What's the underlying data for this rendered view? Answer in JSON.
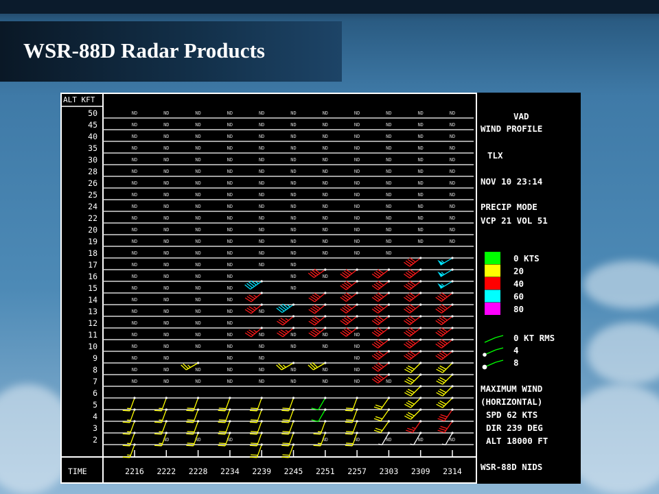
{
  "slide": {
    "title": "WSR-88D Radar Products"
  },
  "chart_data": {
    "type": "vad-wind-profile",
    "ylabel": "ALT KFT",
    "xlabel": "TIME",
    "y_ticks": [
      50,
      45,
      40,
      35,
      30,
      28,
      26,
      25,
      24,
      22,
      20,
      19,
      18,
      17,
      16,
      15,
      14,
      13,
      12,
      11,
      10,
      9,
      8,
      7,
      6,
      5,
      4,
      3,
      2
    ],
    "times": [
      "2216",
      "2222",
      "2228",
      "2234",
      "2239",
      "2245",
      "2251",
      "2257",
      "2303",
      "2309",
      "2314"
    ],
    "no_data_label": "ND",
    "barbs": [
      {
        "t": 0,
        "alts": [
          2,
          3,
          4,
          5,
          6
        ],
        "color": "yellow",
        "dir": 200,
        "spd": 15
      },
      {
        "t": 1,
        "alts": [
          3,
          4,
          5,
          6
        ],
        "color": "yellow",
        "dir": 200,
        "spd": 15
      },
      {
        "t": 2,
        "alts": [
          3,
          4,
          5,
          6
        ],
        "color": "yellow",
        "dir": 200,
        "spd": 18
      },
      {
        "t": 2,
        "alts": [
          9
        ],
        "color": "yellow",
        "dir": 240,
        "spd": 25
      },
      {
        "t": 3,
        "alts": [
          3,
          4,
          5,
          6
        ],
        "color": "yellow",
        "dir": 200,
        "spd": 18
      },
      {
        "t": 4,
        "alts": [
          2,
          3,
          4,
          5,
          6
        ],
        "color": "yellow",
        "dir": 200,
        "spd": 18
      },
      {
        "t": 4,
        "alts": [
          12,
          14,
          15
        ],
        "color": "red",
        "dir": 230,
        "spd": 35
      },
      {
        "t": 4,
        "alts": [
          16
        ],
        "color": "cyan",
        "dir": 235,
        "spd": 45
      },
      {
        "t": 5,
        "alts": [
          2,
          3,
          4,
          5,
          6
        ],
        "color": "yellow",
        "dir": 200,
        "spd": 18
      },
      {
        "t": 5,
        "alts": [
          9
        ],
        "color": "yellow",
        "dir": 240,
        "spd": 25
      },
      {
        "t": 5,
        "alts": [
          12,
          13
        ],
        "color": "red",
        "dir": 230,
        "spd": 35
      },
      {
        "t": 5,
        "alts": [
          14
        ],
        "color": "cyan",
        "dir": 235,
        "spd": 45
      },
      {
        "t": 6,
        "alts": [
          3,
          4
        ],
        "color": "yellow",
        "dir": 200,
        "spd": 15
      },
      {
        "t": 6,
        "alts": [
          5,
          6
        ],
        "color": "green",
        "dir": 210,
        "spd": 12
      },
      {
        "t": 6,
        "alts": [
          9
        ],
        "color": "yellow",
        "dir": 240,
        "spd": 30
      },
      {
        "t": 6,
        "alts": [
          12,
          13,
          14,
          15
        ],
        "color": "red",
        "dir": 230,
        "spd": 38
      },
      {
        "t": 6,
        "alts": [
          17
        ],
        "color": "red",
        "dir": 235,
        "spd": 40
      },
      {
        "t": 7,
        "alts": [
          3,
          4,
          5,
          6
        ],
        "color": "yellow",
        "dir": 200,
        "spd": 18
      },
      {
        "t": 7,
        "alts": [
          12,
          13,
          14,
          15,
          16,
          17
        ],
        "color": "red",
        "dir": 232,
        "spd": 40
      },
      {
        "t": 8,
        "alts": [
          3
        ],
        "color": "white",
        "dir": 210,
        "spd": 5
      },
      {
        "t": 8,
        "alts": [
          4,
          5,
          6
        ],
        "color": "yellow",
        "dir": 215,
        "spd": 20
      },
      {
        "t": 8,
        "alts": [
          8,
          9,
          10,
          11,
          12,
          13,
          14,
          15,
          16,
          17
        ],
        "color": "red",
        "dir": 232,
        "spd": 40
      },
      {
        "t": 9,
        "alts": [
          3
        ],
        "color": "white",
        "dir": 210,
        "spd": 5
      },
      {
        "t": 9,
        "alts": [
          4
        ],
        "color": "red",
        "dir": 215,
        "spd": 25
      },
      {
        "t": 9,
        "alts": [
          5,
          6,
          7,
          8,
          9
        ],
        "color": "yellow",
        "dir": 225,
        "spd": 30
      },
      {
        "t": 9,
        "alts": [
          10,
          11,
          12,
          13,
          14,
          15,
          16,
          17,
          18
        ],
        "color": "red",
        "dir": 232,
        "spd": 42
      },
      {
        "t": 10,
        "alts": [
          3
        ],
        "color": "white",
        "dir": 210,
        "spd": 5
      },
      {
        "t": 10,
        "alts": [
          4,
          5
        ],
        "color": "red",
        "dir": 215,
        "spd": 30
      },
      {
        "t": 10,
        "alts": [
          6,
          7,
          8,
          9
        ],
        "color": "yellow",
        "dir": 225,
        "spd": 30
      },
      {
        "t": 10,
        "alts": [
          10,
          11,
          12,
          13,
          14,
          15
        ],
        "color": "red",
        "dir": 232,
        "spd": 42
      },
      {
        "t": 10,
        "alts": [
          16,
          17,
          18
        ],
        "color": "cyan",
        "dir": 239,
        "spd": 55
      }
    ],
    "side_panel": {
      "title_line1": "VAD",
      "title_line2": "WIND PROFILE",
      "station": "TLX",
      "datetime": "NOV 10 23:14",
      "mode": "PRECIP MODE",
      "vcp": "VCP 21  VOL 51",
      "speed_legend": [
        {
          "label": "0 KTS",
          "color": "#00ff00"
        },
        {
          "label": "20",
          "color": "#ffff00"
        },
        {
          "label": "40",
          "color": "#ff0000"
        },
        {
          "label": "60",
          "color": "#00ffff"
        },
        {
          "label": "80",
          "color": "#ff00ff"
        }
      ],
      "rms_legend": [
        {
          "label": "0 KT RMS"
        },
        {
          "label": "4"
        },
        {
          "label": "8"
        }
      ],
      "max_wind_title1": "MAXIMUM WIND",
      "max_wind_title2": "(HORIZONTAL)",
      "spd": "SPD    62 KTS",
      "dir": "DIR   239 DEG",
      "alt": "ALT 18000 FT",
      "footer": "WSR-88D NIDS"
    }
  }
}
